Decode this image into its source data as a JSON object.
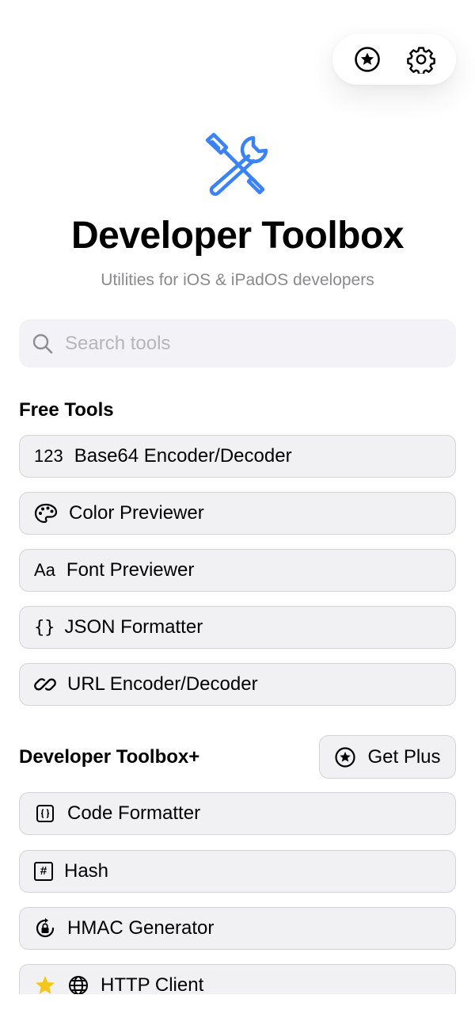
{
  "header": {
    "favorites_icon": "star-circle-icon",
    "settings_icon": "gear-icon"
  },
  "hero": {
    "icon": "wrench-and-screwdriver-icon",
    "title": "Developer Toolbox",
    "subtitle": "Utilities for iOS & iPadOS developers",
    "accent_color": "#3a82f7"
  },
  "search": {
    "placeholder": "Search tools",
    "value": ""
  },
  "free_tools": {
    "title": "Free Tools",
    "items": [
      {
        "icon_text": "123",
        "label": "Base64 Encoder/Decoder",
        "icon": "numbers-icon"
      },
      {
        "icon_text": "",
        "label": "Color Previewer",
        "icon": "palette-icon"
      },
      {
        "icon_text": "Aa",
        "label": "Font Previewer",
        "icon": "text-icon"
      },
      {
        "icon_text": "{}",
        "label": "JSON Formatter",
        "icon": "braces-icon"
      },
      {
        "icon_text": "",
        "label": "URL Encoder/Decoder",
        "icon": "link-icon"
      }
    ]
  },
  "plus_tools": {
    "title": "Developer Toolbox+",
    "get_plus_label": "Get Plus",
    "items": [
      {
        "label": "Code Formatter",
        "icon": "braces-square-icon"
      },
      {
        "icon_text": "#",
        "label": "Hash",
        "icon": "number-sign-square-icon"
      },
      {
        "label": "HMAC Generator",
        "icon": "lock-rotation-icon"
      },
      {
        "label": "HTTP Client",
        "icon": "globe-icon",
        "favorite": true
      }
    ]
  },
  "colors": {
    "favorite_star": "#f5c518",
    "row_background": "#f1f1f3",
    "row_border": "#d3d3d8"
  }
}
